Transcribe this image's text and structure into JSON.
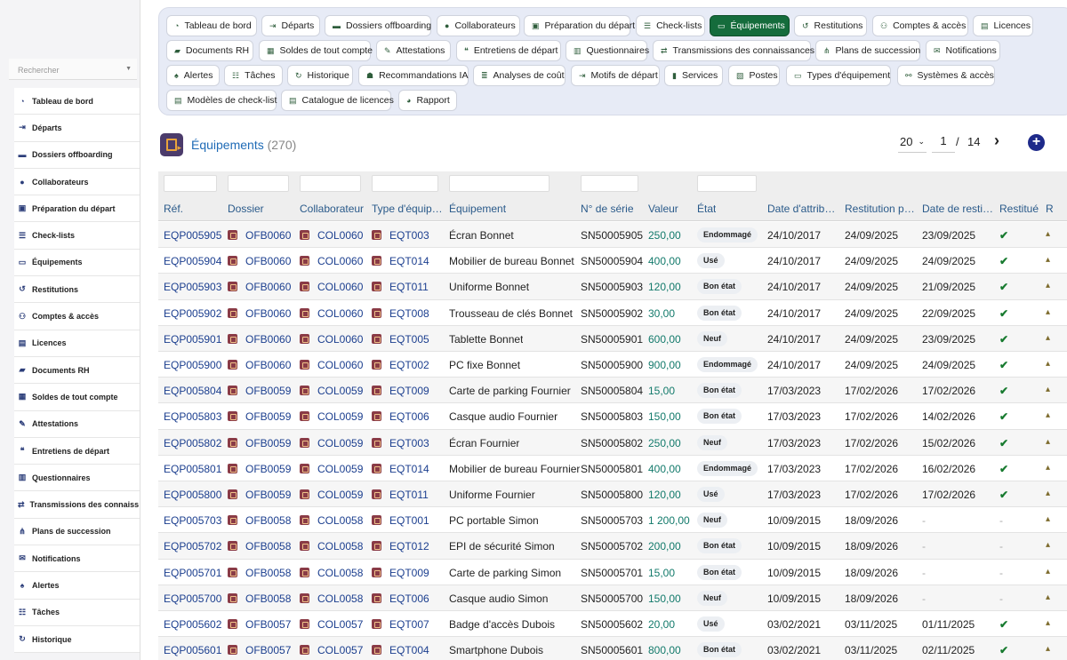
{
  "sidebar": {
    "search_placeholder": "Rechercher",
    "items": [
      {
        "label": "Tableau de bord",
        "icon": "dashboard-icon"
      },
      {
        "label": "Départs",
        "icon": "exit-icon"
      },
      {
        "label": "Dossiers offboarding",
        "icon": "folder-icon"
      },
      {
        "label": "Collaborateurs",
        "icon": "user-icon"
      },
      {
        "label": "Préparation du départ",
        "icon": "clipboard-icon"
      },
      {
        "label": "Check-lists",
        "icon": "list-icon"
      },
      {
        "label": "Équipements",
        "icon": "laptop-icon"
      },
      {
        "label": "Restitutions",
        "icon": "undo-icon"
      },
      {
        "label": "Comptes & accès",
        "icon": "users-icon"
      },
      {
        "label": "Licences",
        "icon": "license-icon"
      },
      {
        "label": "Documents RH",
        "icon": "folder-open-icon"
      },
      {
        "label": "Soldes de tout compte",
        "icon": "money-icon"
      },
      {
        "label": "Attestations",
        "icon": "signature-icon"
      },
      {
        "label": "Entretiens de départ",
        "icon": "comments-icon"
      },
      {
        "label": "Questionnaires",
        "icon": "poll-icon"
      },
      {
        "label": "Transmissions des connaiss…",
        "icon": "exchange-icon"
      },
      {
        "label": "Plans de succession",
        "icon": "sitemap-icon"
      },
      {
        "label": "Notifications",
        "icon": "envelope-icon"
      },
      {
        "label": "Alertes",
        "icon": "bell-icon"
      },
      {
        "label": "Tâches",
        "icon": "tasks-icon"
      },
      {
        "label": "Historique",
        "icon": "history-icon"
      }
    ]
  },
  "topnav": {
    "rows": [
      [
        {
          "label": "Tableau de bord",
          "icon": "dashboard-icon",
          "active": false
        },
        {
          "label": "Départs",
          "icon": "exit-icon",
          "active": false
        },
        {
          "label": "Dossiers offboarding",
          "icon": "folder-icon",
          "active": false
        },
        {
          "label": "Collaborateurs",
          "icon": "user-icon",
          "active": false
        },
        {
          "label": "Préparation du départ",
          "icon": "clipboard-icon",
          "active": false
        },
        {
          "label": "Check-lists",
          "icon": "list-icon",
          "active": false
        },
        {
          "label": "Équipements",
          "icon": "laptop-icon",
          "active": true
        },
        {
          "label": "Restitutions",
          "icon": "undo-icon",
          "active": false
        },
        {
          "label": "Comptes & accès",
          "icon": "users-icon",
          "active": false
        },
        {
          "label": "Licences",
          "icon": "license-icon",
          "active": false
        }
      ],
      [
        {
          "label": "Documents RH",
          "icon": "folder-open-icon",
          "active": false
        },
        {
          "label": "Soldes de tout compte",
          "icon": "money-icon",
          "active": false
        },
        {
          "label": "Attestations",
          "icon": "signature-icon",
          "active": false
        },
        {
          "label": "Entretiens de départ",
          "icon": "comments-icon",
          "active": false
        },
        {
          "label": "Questionnaires",
          "icon": "poll-icon",
          "active": false
        },
        {
          "label": "Transmissions des connaissances",
          "icon": "exchange-icon",
          "active": false
        },
        {
          "label": "Plans de succession",
          "icon": "sitemap-icon",
          "active": false
        },
        {
          "label": "Notifications",
          "icon": "envelope-icon",
          "active": false
        }
      ],
      [
        {
          "label": "Alertes",
          "icon": "bell-icon",
          "active": false
        },
        {
          "label": "Tâches",
          "icon": "tasks-icon",
          "active": false
        },
        {
          "label": "Historique",
          "icon": "history-icon",
          "active": false
        },
        {
          "label": "Recommandations IA",
          "icon": "robot-icon",
          "active": false
        },
        {
          "label": "Analyses de coût",
          "icon": "coins-icon",
          "active": false
        },
        {
          "label": "Motifs de départ",
          "icon": "exit-icon",
          "active": false
        },
        {
          "label": "Services",
          "icon": "building-icon",
          "active": false
        },
        {
          "label": "Postes",
          "icon": "id-card-icon",
          "active": false
        },
        {
          "label": "Types d'équipement",
          "icon": "laptop-icon",
          "active": false
        },
        {
          "label": "Systèmes & accès",
          "icon": "network-icon",
          "active": false
        }
      ],
      [
        {
          "label": "Modèles de check-list",
          "icon": "list-alt-icon",
          "active": false
        },
        {
          "label": "Catalogue de licences",
          "icon": "license-icon",
          "active": false
        },
        {
          "label": "Rapport",
          "icon": "chart-pie-icon",
          "active": false
        }
      ]
    ]
  },
  "page": {
    "title": "Équipements",
    "count": "(270)"
  },
  "pager": {
    "page_size": "20",
    "current": "1",
    "separator": "/",
    "total": "14"
  },
  "table": {
    "columns": [
      "Réf.",
      "Dossier",
      "Collaborateur",
      "Type d'équip…",
      "Équipement",
      "N° de série",
      "Valeur",
      "État",
      "Date d'attrib…",
      "Restitution p…",
      "Date de resti…",
      "Restitué",
      "R"
    ],
    "rows": [
      [
        "EQP005905",
        "OFB0060",
        "COL0060",
        "EQT003",
        "Écran Bonnet",
        "SN50005905",
        "250,00",
        "Endommagé",
        "24/10/2017",
        "24/09/2025",
        "23/09/2025",
        "✔"
      ],
      [
        "EQP005904",
        "OFB0060",
        "COL0060",
        "EQT014",
        "Mobilier de bureau Bonnet",
        "SN50005904",
        "400,00",
        "Usé",
        "24/10/2017",
        "24/09/2025",
        "24/09/2025",
        "✔"
      ],
      [
        "EQP005903",
        "OFB0060",
        "COL0060",
        "EQT011",
        "Uniforme Bonnet",
        "SN50005903",
        "120,00",
        "Bon état",
        "24/10/2017",
        "24/09/2025",
        "21/09/2025",
        "✔"
      ],
      [
        "EQP005902",
        "OFB0060",
        "COL0060",
        "EQT008",
        "Trousseau de clés Bonnet",
        "SN50005902",
        "30,00",
        "Bon état",
        "24/10/2017",
        "24/09/2025",
        "22/09/2025",
        "✔"
      ],
      [
        "EQP005901",
        "OFB0060",
        "COL0060",
        "EQT005",
        "Tablette Bonnet",
        "SN50005901",
        "600,00",
        "Neuf",
        "24/10/2017",
        "24/09/2025",
        "23/09/2025",
        "✔"
      ],
      [
        "EQP005900",
        "OFB0060",
        "COL0060",
        "EQT002",
        "PC fixe Bonnet",
        "SN50005900",
        "900,00",
        "Endommagé",
        "24/10/2017",
        "24/09/2025",
        "24/09/2025",
        "✔"
      ],
      [
        "EQP005804",
        "OFB0059",
        "COL0059",
        "EQT009",
        "Carte de parking Fournier",
        "SN50005804",
        "15,00",
        "Bon état",
        "17/03/2023",
        "17/02/2026",
        "17/02/2026",
        "✔"
      ],
      [
        "EQP005803",
        "OFB0059",
        "COL0059",
        "EQT006",
        "Casque audio Fournier",
        "SN50005803",
        "150,00",
        "Bon état",
        "17/03/2023",
        "17/02/2026",
        "14/02/2026",
        "✔"
      ],
      [
        "EQP005802",
        "OFB0059",
        "COL0059",
        "EQT003",
        "Écran Fournier",
        "SN50005802",
        "250,00",
        "Neuf",
        "17/03/2023",
        "17/02/2026",
        "15/02/2026",
        "✔"
      ],
      [
        "EQP005801",
        "OFB0059",
        "COL0059",
        "EQT014",
        "Mobilier de bureau Fournier",
        "SN50005801",
        "400,00",
        "Endommagé",
        "17/03/2023",
        "17/02/2026",
        "16/02/2026",
        "✔"
      ],
      [
        "EQP005800",
        "OFB0059",
        "COL0059",
        "EQT011",
        "Uniforme Fournier",
        "SN50005800",
        "120,00",
        "Usé",
        "17/03/2023",
        "17/02/2026",
        "17/02/2026",
        "✔"
      ],
      [
        "EQP005703",
        "OFB0058",
        "COL0058",
        "EQT001",
        "PC portable Simon",
        "SN50005703",
        "1 200,00",
        "Neuf",
        "10/09/2015",
        "18/09/2026",
        "-",
        "-"
      ],
      [
        "EQP005702",
        "OFB0058",
        "COL0058",
        "EQT012",
        "EPI de sécurité Simon",
        "SN50005702",
        "200,00",
        "Bon état",
        "10/09/2015",
        "18/09/2026",
        "-",
        "-"
      ],
      [
        "EQP005701",
        "OFB0058",
        "COL0058",
        "EQT009",
        "Carte de parking Simon",
        "SN50005701",
        "15,00",
        "Bon état",
        "10/09/2015",
        "18/09/2026",
        "-",
        "-"
      ],
      [
        "EQP005700",
        "OFB0058",
        "COL0058",
        "EQT006",
        "Casque audio Simon",
        "SN50005700",
        "150,00",
        "Neuf",
        "10/09/2015",
        "18/09/2026",
        "-",
        "-"
      ],
      [
        "EQP005602",
        "OFB0057",
        "COL0057",
        "EQT007",
        "Badge d'accès Dubois",
        "SN50005602",
        "20,00",
        "Usé",
        "03/02/2021",
        "03/11/2025",
        "01/11/2025",
        "✔"
      ],
      [
        "EQP005601",
        "OFB0057",
        "COL0057",
        "EQT004",
        "Smartphone Dubois",
        "SN50005601",
        "800,00",
        "Bon état",
        "03/02/2021",
        "03/11/2025",
        "02/11/2025",
        "✔"
      ]
    ]
  },
  "colors": {
    "accent": "#156c3c",
    "link": "#1c3f8f",
    "money": "#137a6b",
    "nav_bg": "#e7ebf6"
  }
}
